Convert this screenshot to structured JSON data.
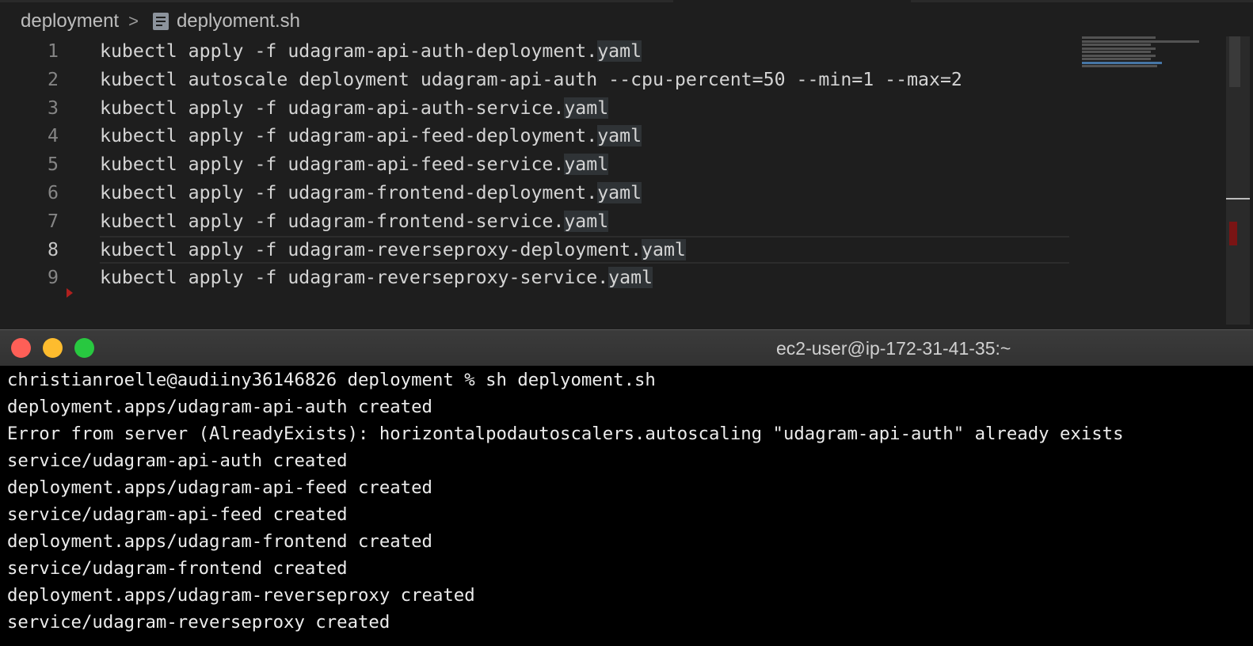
{
  "editor": {
    "breadcrumb": {
      "folder": "deployment",
      "separator": ">",
      "file": "deplyoment.sh"
    },
    "current_line": 8,
    "lines": [
      {
        "number": "1",
        "text": "kubectl apply -f udagram-api-auth-deployment.",
        "ext": "yaml"
      },
      {
        "number": "2",
        "text": "kubectl autoscale deployment udagram-api-auth --cpu-percent=50 --min=1 --max=2",
        "ext": ""
      },
      {
        "number": "3",
        "text": "kubectl apply -f udagram-api-auth-service.",
        "ext": "yaml"
      },
      {
        "number": "4",
        "text": "kubectl apply -f udagram-api-feed-deployment.",
        "ext": "yaml"
      },
      {
        "number": "5",
        "text": "kubectl apply -f udagram-api-feed-service.",
        "ext": "yaml"
      },
      {
        "number": "6",
        "text": "kubectl apply -f udagram-frontend-deployment.",
        "ext": "yaml"
      },
      {
        "number": "7",
        "text": "kubectl apply -f udagram-frontend-service.",
        "ext": "yaml"
      },
      {
        "number": "8",
        "text": "kubectl apply -f udagram-reverseproxy-deployment.",
        "ext": "yaml"
      },
      {
        "number": "9",
        "text": "kubectl apply -f udagram-reverseproxy-service.",
        "ext": "yaml"
      }
    ]
  },
  "terminal": {
    "title": "ec2-user@ip-172-31-41-35:~",
    "lines": [
      "christianroelle@audiiny36146826 deployment % sh deplyoment.sh",
      "deployment.apps/udagram-api-auth created",
      "Error from server (AlreadyExists): horizontalpodautoscalers.autoscaling \"udagram-api-auth\" already exists",
      "service/udagram-api-auth created",
      "deployment.apps/udagram-api-feed created",
      "service/udagram-api-feed created",
      "deployment.apps/udagram-frontend created",
      "service/udagram-frontend created",
      "deployment.apps/udagram-reverseproxy created",
      "service/udagram-reverseproxy created"
    ]
  },
  "colors": {
    "editor_bg": "#1e1e1e",
    "terminal_bg": "#000000",
    "close": "#fe5f57",
    "minimize": "#febc2e",
    "maximize": "#28c840"
  }
}
